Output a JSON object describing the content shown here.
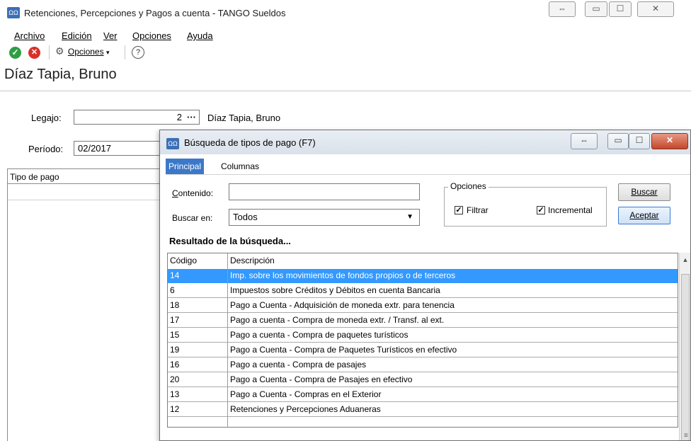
{
  "window": {
    "title": "Retenciones, Percepciones y Pagos a cuenta - TANGO Sueldos",
    "icon": "tango-app-icon",
    "controls": [
      "⇔",
      "▭",
      "☐",
      "✕"
    ]
  },
  "menu": [
    "Archivo",
    "Edición",
    "Ver",
    "Opciones",
    "Ayuda"
  ],
  "toolbar": {
    "accept_icon": "check-circle-icon",
    "cancel_icon": "x-circle-icon",
    "options_label": "Opciones",
    "help_icon": "help-icon"
  },
  "employee_title": "Díaz Tapia, Bruno",
  "form": {
    "legajo_label": "Legajo:",
    "legajo_value": "2",
    "legajo_name": "Díaz Tapia, Bruno",
    "periodo_label": "Período:",
    "periodo_value": "02/2017"
  },
  "grid": {
    "header": "Tipo de pago"
  },
  "dialog": {
    "title": "Búsqueda de tipos de pago (F7)",
    "tabs": [
      "Principal",
      "Columnas"
    ],
    "contenido_label": "Contenido:",
    "contenido_value": "",
    "buscar_en_label": "Buscar en:",
    "buscar_en_value": "Todos",
    "options_group": "Opciones",
    "filtrar_label": "Filtrar",
    "filtrar_checked": true,
    "incremental_label": "Incremental",
    "incremental_checked": true,
    "buscar_button": "Buscar",
    "aceptar_button": "Aceptar",
    "results_title": "Resultado de la búsqueda...",
    "columns": [
      "Código",
      "Descripción"
    ],
    "rows": [
      {
        "code": "14",
        "desc": "Imp. sobre los movimientos de fondos propios o de terceros",
        "selected": true
      },
      {
        "code": "6",
        "desc": "Impuestos sobre Créditos y Débitos en cuenta Bancaria"
      },
      {
        "code": "18",
        "desc": "Pago a Cuenta - Adquisición de moneda extr. para tenencia"
      },
      {
        "code": "17",
        "desc": "Pago a cuenta - Compra de moneda extr. / Transf. al ext."
      },
      {
        "code": "15",
        "desc": "Pago a cuenta - Compra de paquetes turísticos"
      },
      {
        "code": "19",
        "desc": "Pago a Cuenta - Compra de Paquetes Turísticos en efectivo"
      },
      {
        "code": "16",
        "desc": "Pago a cuenta - Compra de pasajes"
      },
      {
        "code": "20",
        "desc": "Pago a Cuenta - Compra de Pasajes en efectivo"
      },
      {
        "code": "13",
        "desc": "Pago a Cuenta - Compras en el Exterior"
      },
      {
        "code": "12",
        "desc": "Retenciones y Percepciones Aduaneras"
      }
    ],
    "selection_color": "#3399ff"
  }
}
